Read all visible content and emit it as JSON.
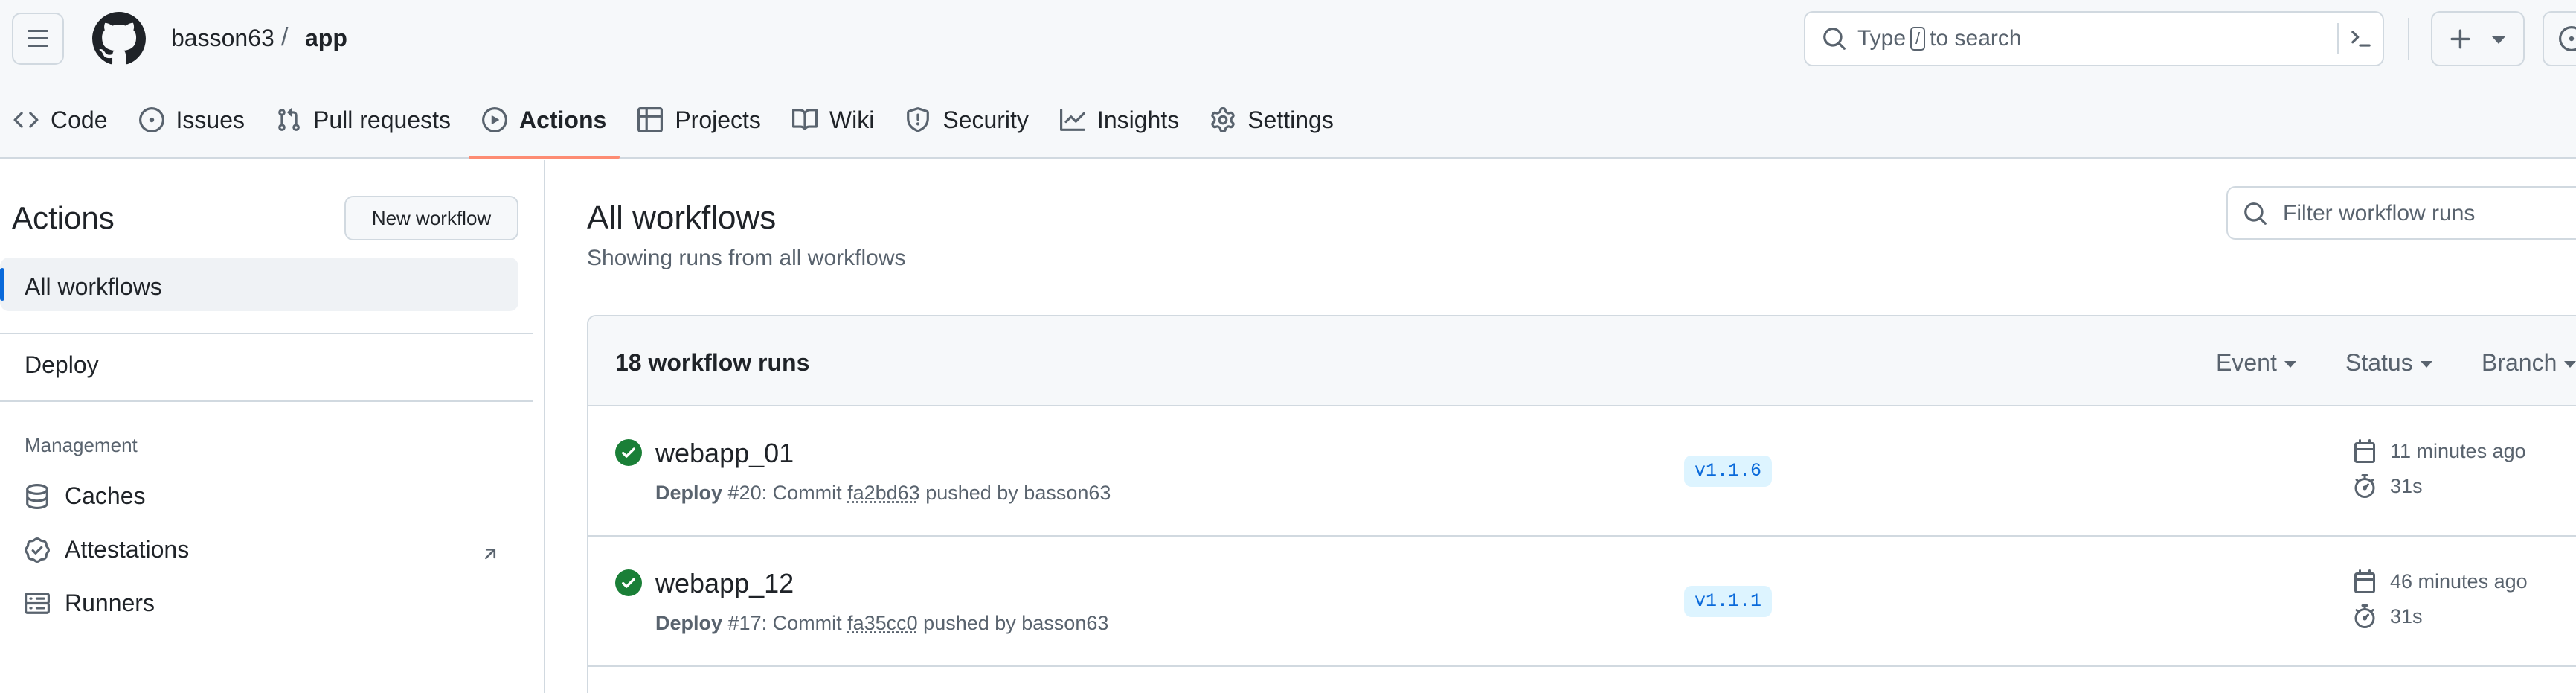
{
  "header": {
    "owner": "basson63",
    "separator": "/",
    "repo": "app",
    "search_prefix": "Type",
    "search_key": "/",
    "search_suffix": "to search"
  },
  "nav": {
    "tabs": [
      {
        "label": "Code",
        "icon": "code-icon"
      },
      {
        "label": "Issues",
        "icon": "issue-opened-icon"
      },
      {
        "label": "Pull requests",
        "icon": "git-pull-request-icon"
      },
      {
        "label": "Actions",
        "icon": "play-icon",
        "active": true
      },
      {
        "label": "Projects",
        "icon": "table-icon"
      },
      {
        "label": "Wiki",
        "icon": "book-icon"
      },
      {
        "label": "Security",
        "icon": "shield-icon"
      },
      {
        "label": "Insights",
        "icon": "graph-icon"
      },
      {
        "label": "Settings",
        "icon": "gear-icon"
      }
    ]
  },
  "sidebar": {
    "title": "Actions",
    "new_workflow_label": "New workflow",
    "all_workflows_label": "All workflows",
    "workflows": [
      "Deploy"
    ],
    "management_heading": "Management",
    "management_items": [
      {
        "label": "Caches",
        "icon": "database-icon"
      },
      {
        "label": "Attestations",
        "icon": "verified-icon"
      },
      {
        "label": "Runners",
        "icon": "server-icon"
      }
    ]
  },
  "main": {
    "title": "All workflows",
    "subtitle": "Showing runs from all workflows",
    "filter_placeholder": "Filter workflow runs",
    "runs_count_label": "18 workflow runs",
    "filters": [
      "Event",
      "Status",
      "Branch"
    ],
    "runs": [
      {
        "name": "webapp_01",
        "workflow": "Deploy",
        "meta_mid": " #20: Commit ",
        "commit": "fa2bd63",
        "meta_end": " pushed by basson63",
        "branch": "v1.1.6",
        "time_ago": "11 minutes ago",
        "duration": "31s",
        "status": "success"
      },
      {
        "name": "webapp_12",
        "workflow": "Deploy",
        "meta_mid": " #17: Commit ",
        "commit": "fa35cc0",
        "meta_end": " pushed by basson63",
        "branch": "v1.1.1",
        "time_ago": "46 minutes ago",
        "duration": "31s",
        "status": "success"
      }
    ]
  },
  "colors": {
    "accent": "#0969da",
    "success": "#1a7f37",
    "tab_underline": "#fd8c73",
    "branch_bg": "#ddf4ff"
  }
}
